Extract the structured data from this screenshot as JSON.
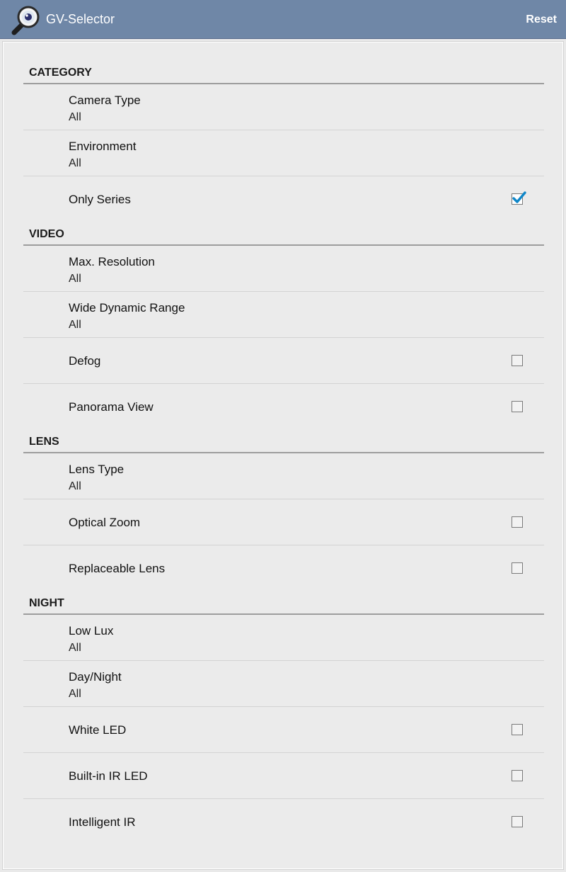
{
  "app": {
    "title": "GV-Selector",
    "reset_label": "Reset"
  },
  "sections": [
    {
      "header": "CATEGORY",
      "items": [
        {
          "title": "Camera Type",
          "summary": "All"
        },
        {
          "title": "Environment",
          "summary": "All"
        },
        {
          "title": "Only Series",
          "checked": true
        }
      ]
    },
    {
      "header": "VIDEO",
      "items": [
        {
          "title": "Max. Resolution",
          "summary": "All"
        },
        {
          "title": "Wide Dynamic Range",
          "summary": "All"
        },
        {
          "title": "Defog",
          "checked": false
        },
        {
          "title": "Panorama View",
          "checked": false
        }
      ]
    },
    {
      "header": "LENS",
      "items": [
        {
          "title": "Lens Type",
          "summary": "All"
        },
        {
          "title": "Optical Zoom",
          "checked": false
        },
        {
          "title": "Replaceable Lens",
          "checked": false
        }
      ]
    },
    {
      "header": "NIGHT",
      "items": [
        {
          "title": "Low Lux",
          "summary": "All"
        },
        {
          "title": "Day/Night",
          "summary": "All"
        },
        {
          "title": "White LED",
          "checked": false
        },
        {
          "title": "Built-in IR LED",
          "checked": false
        },
        {
          "title": "Intelligent IR",
          "checked": false
        }
      ]
    }
  ]
}
